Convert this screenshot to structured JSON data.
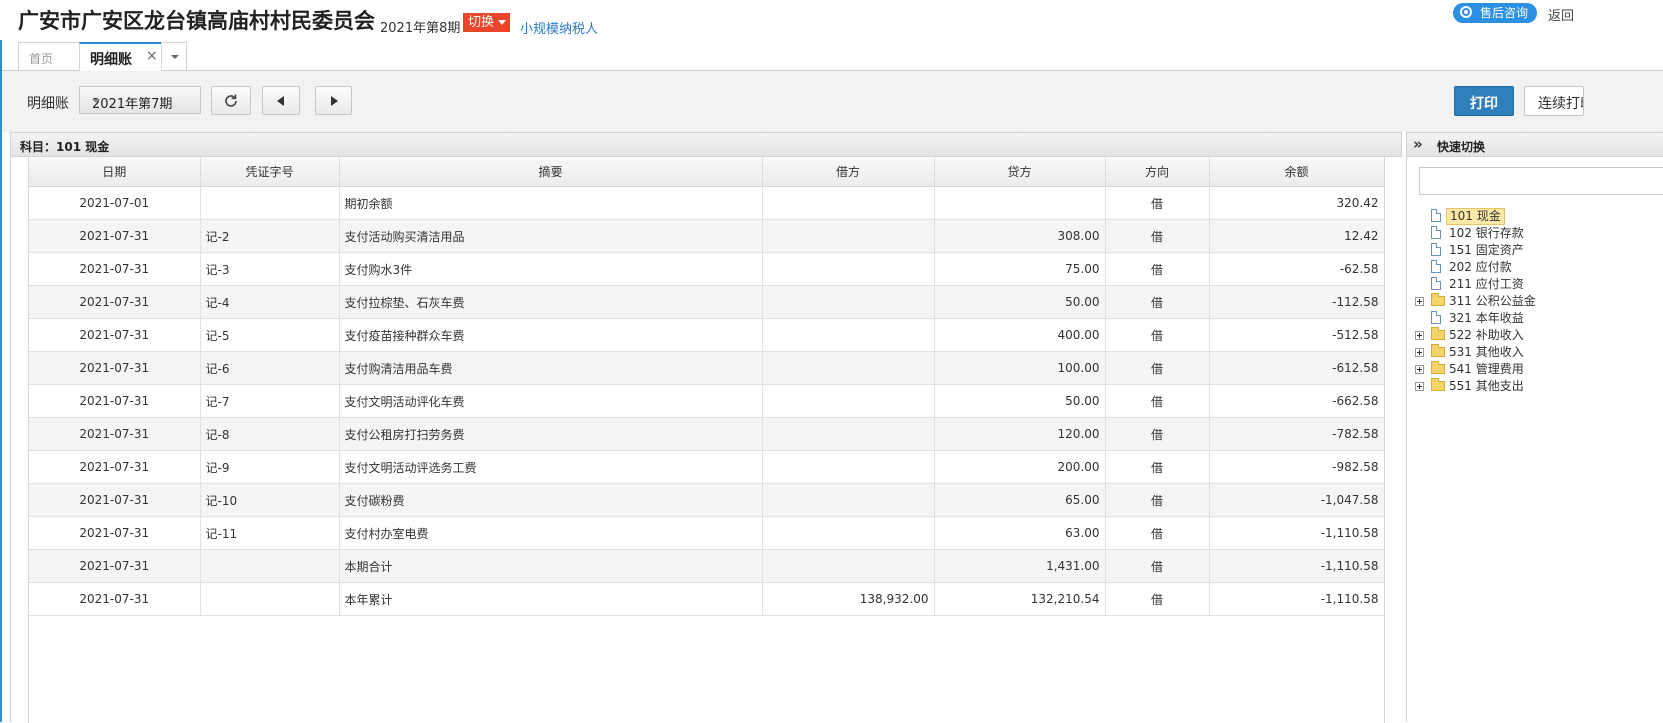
{
  "header": {
    "company": "广安市广安区龙台镇高庙村村民委员会",
    "period": "2021年第8期",
    "switch_label": "切换",
    "taxpayer": "小规模纳税人",
    "service_label": "售后咨询",
    "back_label": "返回"
  },
  "tabs": {
    "home": "首页",
    "detail": "明细账",
    "close": "×"
  },
  "toolbar": {
    "label": "明细账",
    "period_value": "2021年第7期",
    "print_label": "打印",
    "continuous_label": "连续打印"
  },
  "panel": {
    "title": "科目：101  现金"
  },
  "table": {
    "columns": [
      "日期",
      "凭证字号",
      "摘要",
      "借方",
      "贷方",
      "方向",
      "余额"
    ],
    "rows": [
      {
        "date": "2021-07-01",
        "voucher": "",
        "summary": "期初余额",
        "debit": "",
        "credit": "",
        "dir": "借",
        "balance": "320.42"
      },
      {
        "date": "2021-07-31",
        "voucher": "记-2",
        "summary": "支付活动购买清洁用品",
        "debit": "",
        "credit": "308.00",
        "dir": "借",
        "balance": "12.42"
      },
      {
        "date": "2021-07-31",
        "voucher": "记-3",
        "summary": "支付购水3件",
        "debit": "",
        "credit": "75.00",
        "dir": "借",
        "balance": "-62.58"
      },
      {
        "date": "2021-07-31",
        "voucher": "记-4",
        "summary": "支付拉棕垫、石灰车费",
        "debit": "",
        "credit": "50.00",
        "dir": "借",
        "balance": "-112.58"
      },
      {
        "date": "2021-07-31",
        "voucher": "记-5",
        "summary": "支付疫苗接种群众车费",
        "debit": "",
        "credit": "400.00",
        "dir": "借",
        "balance": "-512.58"
      },
      {
        "date": "2021-07-31",
        "voucher": "记-6",
        "summary": "支付购清洁用品车费",
        "debit": "",
        "credit": "100.00",
        "dir": "借",
        "balance": "-612.58"
      },
      {
        "date": "2021-07-31",
        "voucher": "记-7",
        "summary": "支付文明活动评化车费",
        "debit": "",
        "credit": "50.00",
        "dir": "借",
        "balance": "-662.58"
      },
      {
        "date": "2021-07-31",
        "voucher": "记-8",
        "summary": "支付公租房打扫劳务费",
        "debit": "",
        "credit": "120.00",
        "dir": "借",
        "balance": "-782.58"
      },
      {
        "date": "2021-07-31",
        "voucher": "记-9",
        "summary": "支付文明活动评选务工费",
        "debit": "",
        "credit": "200.00",
        "dir": "借",
        "balance": "-982.58"
      },
      {
        "date": "2021-07-31",
        "voucher": "记-10",
        "summary": "支付碳粉费",
        "debit": "",
        "credit": "65.00",
        "dir": "借",
        "balance": "-1,047.58"
      },
      {
        "date": "2021-07-31",
        "voucher": "记-11",
        "summary": "支付村办室电费",
        "debit": "",
        "credit": "63.00",
        "dir": "借",
        "balance": "-1,110.58"
      },
      {
        "date": "2021-07-31",
        "voucher": "",
        "summary": "本期合计",
        "debit": "",
        "credit": "1,431.00",
        "dir": "借",
        "balance": "-1,110.58"
      },
      {
        "date": "2021-07-31",
        "voucher": "",
        "summary": "本年累计",
        "debit": "138,932.00",
        "credit": "132,210.54",
        "dir": "借",
        "balance": "-1,110.58"
      }
    ]
  },
  "quick": {
    "title": "快速切换",
    "expand_icon": "»",
    "search_value": "",
    "items": [
      {
        "label": "101 现金",
        "type": "doc",
        "selected": true,
        "expandable": false
      },
      {
        "label": "102 银行存款",
        "type": "doc",
        "selected": false,
        "expandable": false
      },
      {
        "label": "151 固定资产",
        "type": "doc",
        "selected": false,
        "expandable": false
      },
      {
        "label": "202 应付款",
        "type": "doc",
        "selected": false,
        "expandable": false
      },
      {
        "label": "211 应付工资",
        "type": "doc",
        "selected": false,
        "expandable": false
      },
      {
        "label": "311 公积公益金",
        "type": "folder",
        "selected": false,
        "expandable": true
      },
      {
        "label": "321 本年收益",
        "type": "doc",
        "selected": false,
        "expandable": false
      },
      {
        "label": "522 补助收入",
        "type": "folder",
        "selected": false,
        "expandable": true
      },
      {
        "label": "531 其他收入",
        "type": "folder",
        "selected": false,
        "expandable": true
      },
      {
        "label": "541 管理费用",
        "type": "folder",
        "selected": false,
        "expandable": true
      },
      {
        "label": "551 其他支出",
        "type": "folder",
        "selected": false,
        "expandable": true
      }
    ]
  },
  "colors": {
    "accent": "#2f7fbd",
    "switch": "#e8452b",
    "link": "#2b7bc7",
    "service": "#2b8fe2",
    "selected_node": "#fde8a6"
  }
}
